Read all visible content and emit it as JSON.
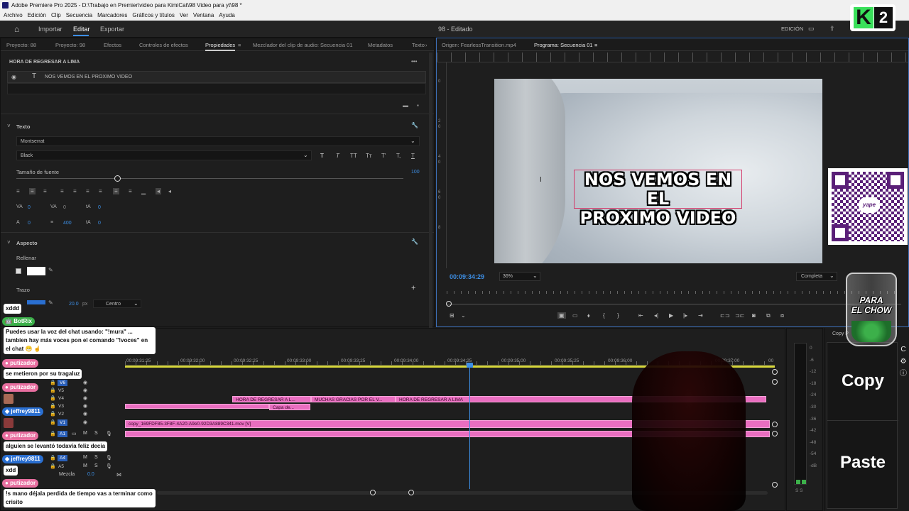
{
  "window": {
    "title": "Adobe Premiere Pro 2025 - D:\\Trabajo en Premier\\video para KimiCat\\98 Video para yt\\98 *"
  },
  "menu": [
    "Archivo",
    "Edición",
    "Clip",
    "Secuencia",
    "Marcadores",
    "Gráficos y títulos",
    "Ver",
    "Ventana",
    "Ayuda"
  ],
  "header": {
    "home": "Inicio",
    "import": "Importar",
    "edit": "Editar",
    "export": "Exportar",
    "project_title": "98 - Editado",
    "workspace": "EDICIÓN"
  },
  "left_panel": {
    "tabs": [
      "Proyecto: 88",
      "Proyecto: 98",
      "Efectos",
      "Controles de efectos",
      "Propiedades",
      "Mezclador del clip de audio: Secuencia 01",
      "Metadatos",
      "Texto"
    ],
    "clip_title": "HORA DE REGRESAR A LIMA",
    "layer_text": "NOS VEMOS EN EL PROXIMO VIDEO",
    "text_section": "Texto",
    "font": "Montserrat",
    "weight": "Black",
    "font_size_label": "Tamaño de fuente",
    "font_size_value": "100",
    "tracking_a": "0",
    "tracking_b": "0",
    "tracking_c": "0",
    "row2_a": "0",
    "row2_b": "400",
    "row2_c": "0",
    "appearance_section": "Aspecto",
    "fill_label": "Rellenar",
    "stroke_label": "Trazo",
    "stroke_value": "20.0",
    "stroke_unit": "px",
    "stroke_pos": "Centro",
    "style_glyphs": [
      "T",
      "T",
      "TT",
      "Tт",
      "T'",
      "T,",
      "T"
    ]
  },
  "program": {
    "tabs": [
      "Origen: FearlessTransition.mp4",
      "Programa: Secuencia 01"
    ],
    "overlay_line1": "NOS VEMOS EN EL",
    "overlay_line2": "PROXIMO VIDEO",
    "timecode": "00:09:34:29",
    "zoom": "36%",
    "quality": "Completa",
    "ruler": [
      "0",
      "2",
      "0",
      "4",
      "0",
      "6",
      "0",
      "8"
    ]
  },
  "timeline": {
    "ticks": [
      "00:09:31:25",
      "00:09:32:00",
      "00:09:32:25",
      "00:09:33:00",
      "00:09:33:25",
      "00:09:34:00",
      "00:09:34:25",
      "00:09:35:00",
      "00:09:35:25",
      "00:09:36:00",
      "00:09:37:00",
      "00"
    ],
    "tracks_v": [
      "V6",
      "V5",
      "V4",
      "V3",
      "V2",
      "V1"
    ],
    "tracks_a": [
      "A1",
      "A4",
      "A5"
    ],
    "mix_label": "Mezcla",
    "mix_value": "0.0",
    "clips": {
      "c1": "HORA DE REGRESAR A L...",
      "c2": "MUCHAS GRACIAS POR EL V...",
      "c3": "HORA DE REGRESAR A LIMA",
      "c4": "Capa de...",
      "c5": "copy_169FDF85-3F8F-4A20-A9e0-92D3A889C341.mov [V]"
    },
    "meter_ticks": [
      "0",
      "-6",
      "-12",
      "-18",
      "-24",
      "-30",
      "-36",
      "-42",
      "-48",
      "-54",
      "-dB"
    ],
    "meter_ss": "S S"
  },
  "overlay": {
    "k2": "2",
    "yape": "yape",
    "jar_line1": "PARA",
    "jar_line2": "EL CHOW",
    "copy": "Copy",
    "paste": "Paste",
    "copy_small": "Copy P"
  },
  "chat": [
    {
      "msg": "xddd"
    },
    {
      "name": "BotRix",
      "msg": "Puedes usar la voz del chat usando: \"!mura\" ... tambien hay más voces pon el comando \"!voces\" en el chat 😁 ☝️"
    },
    {
      "name": "putizador",
      "msg": "se metieron por su tragaluz"
    },
    {
      "name": "putizador",
      "msg": ""
    },
    {
      "name": "jeffrey9811",
      "msg": ""
    },
    {
      "name": "putizador",
      "msg": "alguien se levantó todavía feliz decia"
    },
    {
      "name": "jeffrey9811",
      "msg": "xdd"
    },
    {
      "name": "putizador",
      "msg": "!s mano déjala perdida de tiempo vas a terminar como crisito"
    }
  ]
}
